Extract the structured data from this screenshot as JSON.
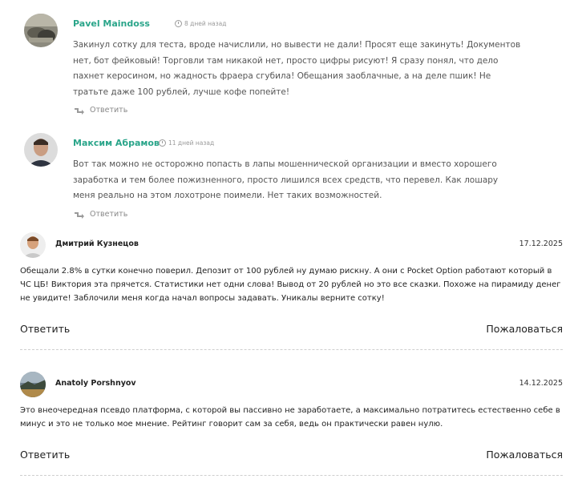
{
  "comments_nested": [
    {
      "author": "Pavel Maindoss",
      "time": "8 дней назад",
      "text": "Закинул сотку для теста, вроде начислили, но вывести не дали! Просят еще закинуть! Документов нет, бот фейковый! Торговли там никакой нет, просто цифры рисуют! Я сразу понял, что дело пахнет керосином, но жадность фраера сгубила! Обещания заоблачные, а на деле пшик! Не тратьте даже 100 рублей, лучше кофе попейте!",
      "reply_label": "Ответить"
    },
    {
      "author": "Максим Абрамов",
      "time": "11 дней назад",
      "text": "Вот так можно не осторожно попасть в лапы мошеннической организации и вместо хорошего заработка и тем более пожизненного, просто лишился всех средств, что перевел. Как лошару меня реально на этом лохотроне поимели. Нет таких возможностей.",
      "reply_label": "Ответить"
    }
  ],
  "comments_flat": [
    {
      "author": "Дмитрий Кузнецов",
      "date": "17.12.2025",
      "text": "Обещали 2.8% в сутки конечно поверил. Депозит от 100 рублей ну думаю рискну. А они с Pocket Option работают который в ЧС ЦБ! Виктория эта прячется. Статистики нет одни слова! Вывод от 20 рублей но это все сказки. Похоже на пирамиду денег не увидите! Заблочили меня когда начал вопросы задавать. Уникалы верните сотку!",
      "reply_label": "Ответить",
      "report_label": "Пожаловаться"
    },
    {
      "author": "Anatoly Porshnyov",
      "date": "14.12.2025",
      "text": "Это внеочередная псевдо платформа, с которой вы пассивно не заработаете, а максимально потратитесь естественно себе в минус и это не только мое мнение. Рейтинг говорит сам за себя, ведь он практически равен нулю.",
      "reply_label": "Ответить",
      "report_label": "Пожаловаться"
    }
  ],
  "colors": {
    "accent": "#2aa58a",
    "muted": "#9a9a9a"
  }
}
